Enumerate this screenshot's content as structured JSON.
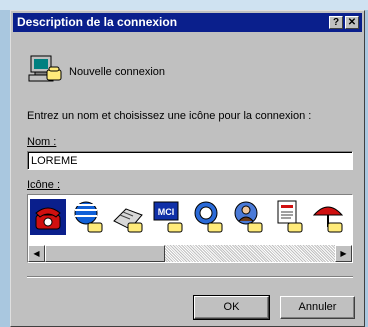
{
  "window": {
    "title": "Description de la connexion",
    "help_label": "?",
    "close_label": "✕"
  },
  "connection": {
    "name_display": "Nouvelle connexion",
    "icon": "dialup-computer-icon"
  },
  "form": {
    "prompt": "Entrez un nom et choisissez une icône pour la connexion :",
    "name_label": "Nom :",
    "name_value": "LOREME",
    "icon_label": "Icône :"
  },
  "icons": [
    "red-telephone-icon",
    "globe-phone-icon",
    "fax-phone-icon",
    "mci-phone-icon",
    "ge-globe-phone-icon",
    "person-phone-icon",
    "document-phone-icon",
    "umbrella-phone-icon"
  ],
  "buttons": {
    "ok": "OK",
    "cancel": "Annuler"
  },
  "colors": {
    "titlebar": "#0a1f8c",
    "dialog_face": "#c0c0c0"
  }
}
